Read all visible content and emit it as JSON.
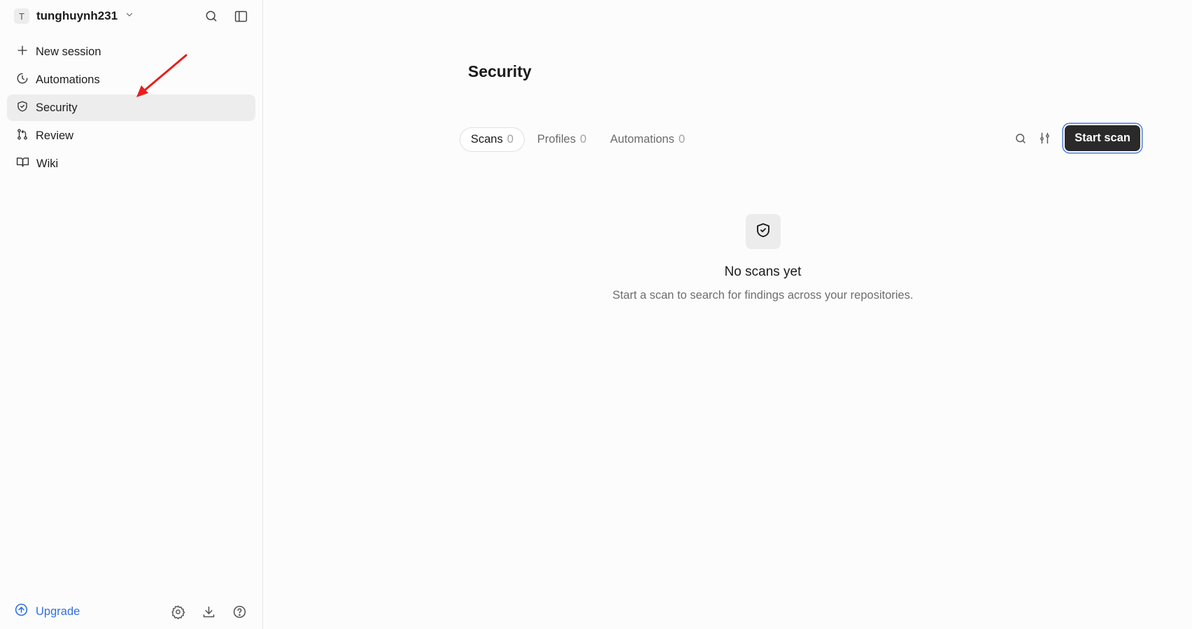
{
  "workspace": {
    "avatar_initial": "T",
    "name": "tunghuynh231"
  },
  "sidebar": {
    "items": [
      {
        "label": "New session",
        "icon": "plus-icon"
      },
      {
        "label": "Automations",
        "icon": "clock-icon"
      },
      {
        "label": "Security",
        "icon": "shield-icon",
        "active": true
      },
      {
        "label": "Review",
        "icon": "git-pull-request-icon"
      },
      {
        "label": "Wiki",
        "icon": "book-icon"
      }
    ],
    "upgrade_label": "Upgrade"
  },
  "main": {
    "title": "Security",
    "tabs": [
      {
        "label": "Scans",
        "count": "0",
        "active": true
      },
      {
        "label": "Profiles",
        "count": "0"
      },
      {
        "label": "Automations",
        "count": "0"
      }
    ],
    "start_scan_label": "Start scan",
    "empty": {
      "title": "No scans yet",
      "description": "Start a scan to search for findings across your repositories."
    }
  },
  "colors": {
    "accent": "#2f6fdf",
    "primary_button": "#2a2a2a",
    "active_nav_bg": "#ededed",
    "annotation_arrow": "#e8201a"
  }
}
